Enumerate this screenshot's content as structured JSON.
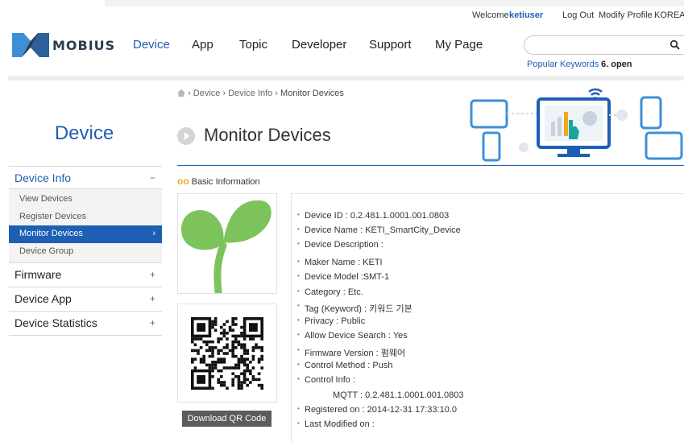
{
  "util": {
    "welcome": "Welcome",
    "username": "ketiuser",
    "logout": "Log Out",
    "modify_profile": "Modify Profile",
    "language": "KOREAN"
  },
  "brand": {
    "name": "MOBIUS",
    "accent": "#1d5fb5",
    "dark": "#2d3a52"
  },
  "nav": [
    {
      "label": "Device",
      "active": true
    },
    {
      "label": "App"
    },
    {
      "label": "Topic"
    },
    {
      "label": "Developer"
    },
    {
      "label": "Support"
    },
    {
      "label": "My Page"
    }
  ],
  "search": {
    "placeholder": "",
    "value": "",
    "icon": "search-icon"
  },
  "popular": {
    "label": "Popular Keywords",
    "keyword": "6. open"
  },
  "sidebar": {
    "title": "Device",
    "sections": [
      {
        "label": "Device Info",
        "toggle": "−",
        "open": true,
        "items": [
          {
            "label": "View Devices"
          },
          {
            "label": "Register Devices"
          },
          {
            "label": "Monitor Devices",
            "selected": true,
            "chevron": "›"
          },
          {
            "label": "Device Group"
          }
        ]
      },
      {
        "label": "Firmware",
        "toggle": "+"
      },
      {
        "label": "Device App",
        "toggle": "+"
      },
      {
        "label": "Device Statistics",
        "toggle": "+"
      }
    ]
  },
  "breadcrumb": {
    "home_icon": "home-icon",
    "sep": "›",
    "items": [
      "Device",
      "Device Info",
      "Monitor Devices"
    ]
  },
  "page": {
    "title": "Monitor Devices"
  },
  "basic": {
    "heading": "Basic Information",
    "qr_button": "Download QR Code",
    "fields": [
      {
        "k": "Device ID",
        "sep": " : ",
        "v": "0.2.481.1.0001.001.0803"
      },
      {
        "k": "Device Name",
        "sep": " : ",
        "v": "KETI_SmartCity_Device"
      },
      {
        "k": "Device Description",
        "sep": " : ",
        "v": ""
      },
      {
        "k": "Maker Name",
        "sep": " : ",
        "v": "KETI"
      },
      {
        "k": "Device Model",
        "sep": " :",
        "v": "SMT-1"
      },
      {
        "k": "Category",
        "sep": " : ",
        "v": "Etc."
      },
      {
        "k": "Tag (Keyword)",
        "sep": " : ",
        "v": "키워드 기본"
      },
      {
        "k": "Privacy",
        "sep": " : ",
        "v": "Public"
      },
      {
        "k": "Allow Device Search",
        "sep": " : ",
        "v": "Yes"
      },
      {
        "k": "Firmware Version",
        "sep": " : ",
        "v": "펌웨어"
      },
      {
        "k": "Control Method",
        "sep": " : ",
        "v": "Push"
      },
      {
        "k": "Control Info",
        "sep": " :",
        "v": ""
      },
      {
        "k": "MQTT",
        "sep": " : ",
        "v": "0.2.481.1.0001.001.0803",
        "indent": true
      },
      {
        "k": "Registered on",
        "sep": " : ",
        "v": "2014-12-31 17:33:10.0"
      },
      {
        "k": "Last Modified on",
        "sep": " :",
        "v": ""
      }
    ]
  }
}
